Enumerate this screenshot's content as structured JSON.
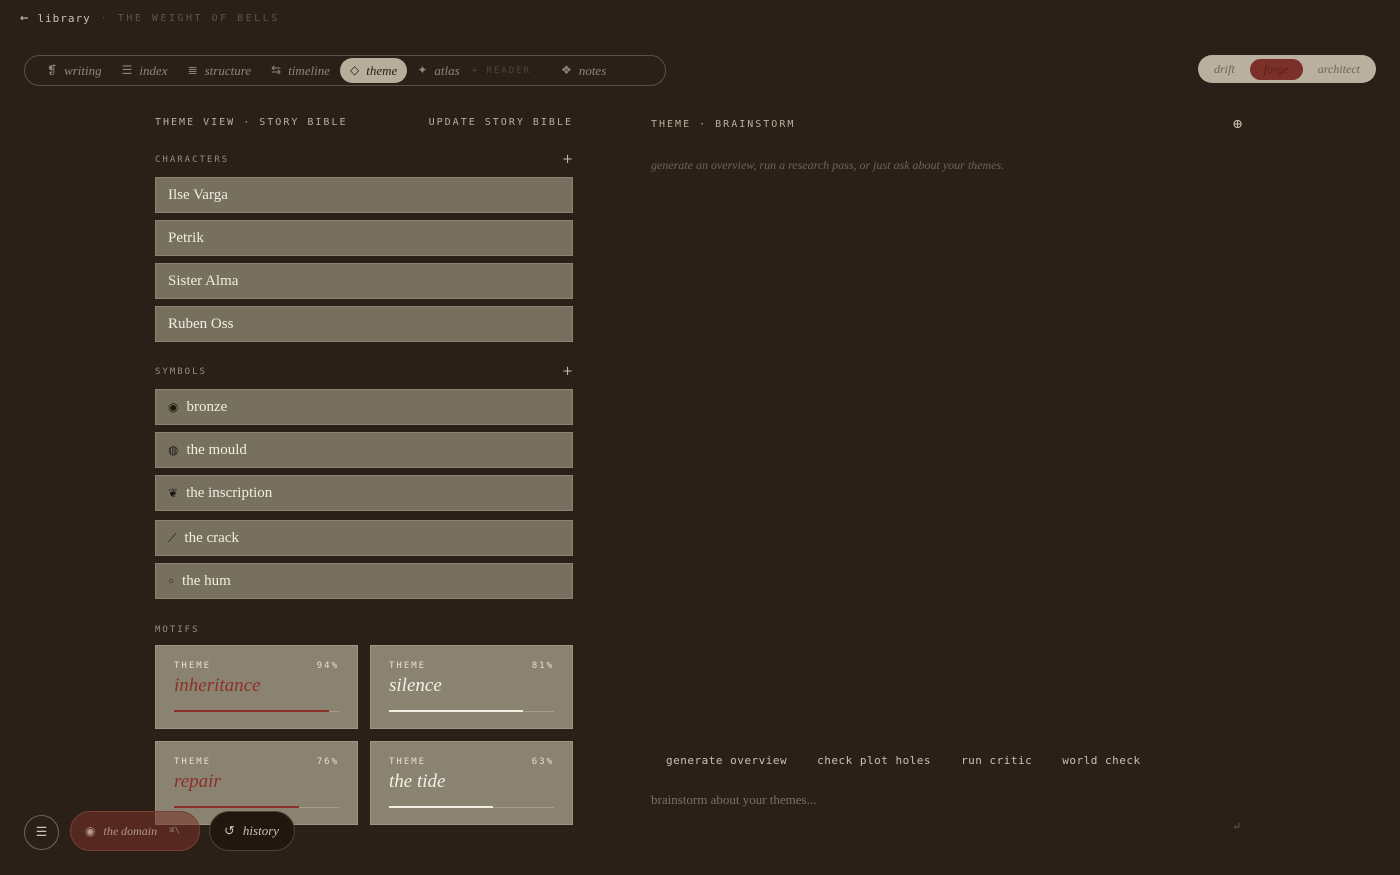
{
  "topbar": {
    "back_icon": "←",
    "back_label": "library",
    "breadcrumb": "· THE WEIGHT OF BELLS"
  },
  "nav": {
    "items": [
      {
        "icon": "❡",
        "label": "writing"
      },
      {
        "icon": "☰",
        "label": "index"
      },
      {
        "icon": "≣",
        "label": "structure"
      },
      {
        "icon": "⇆",
        "label": "timeline"
      },
      {
        "icon": "◇",
        "label": "theme",
        "active": true
      },
      {
        "icon": "✦",
        "label": "atlas"
      },
      {
        "icon": "❖",
        "label": "notes"
      }
    ],
    "reader_label": "+ READER"
  },
  "modes": {
    "items": [
      "drift",
      "forge",
      "architect"
    ],
    "active": "forge"
  },
  "left": {
    "title": "THEME VIEW · STORY BIBLE",
    "update_label": "UPDATE STORY BIBLE",
    "characters_label": "CHARACTERS",
    "characters": [
      "Ilse Varga",
      "Petrik",
      "Sister Alma",
      "Ruben Oss"
    ],
    "symbols_label": "SYMBOLS",
    "symbols": [
      {
        "icon": "◉",
        "name": "bronze"
      },
      {
        "icon": "◍",
        "name": "the mould"
      },
      {
        "icon": "❦",
        "name": "the inscription"
      },
      {
        "icon": "⟋",
        "name": "the crack"
      },
      {
        "icon": "○",
        "name": "the hum"
      }
    ],
    "motifs_label": "MOTIFS",
    "motifs": [
      {
        "kind": "THEME",
        "pct": "94%",
        "value": 0.94,
        "name": "inheritance",
        "accent": true
      },
      {
        "kind": "THEME",
        "pct": "81%",
        "value": 0.81,
        "name": "silence",
        "accent": false
      },
      {
        "kind": "THEME",
        "pct": "76%",
        "value": 0.76,
        "name": "repair",
        "accent": true
      },
      {
        "kind": "THEME",
        "pct": "63%",
        "value": 0.63,
        "name": "the tide",
        "accent": false
      }
    ],
    "plus": "+"
  },
  "right": {
    "title": "THEME · BRAINSTORM",
    "corner_icon": "⊕",
    "hint": "generate an overview, run a research pass, or just ask about your themes.",
    "actions": [
      "generate overview",
      "check plot holes",
      "run critic",
      "world check"
    ],
    "input_placeholder": "brainstorm about your themes...",
    "enter_icon": "↵"
  },
  "bottom": {
    "menu_icon": "☰",
    "domain_label": "the domain",
    "domain_shortcut": "⌘\\",
    "history_label": "history",
    "history_icon": "↺"
  },
  "colors": {
    "background": "#2a2017",
    "card": "#78705f",
    "motif_card": "#8b8372",
    "accent": "#8a2e27",
    "active_tab": "#b7ad9b"
  }
}
